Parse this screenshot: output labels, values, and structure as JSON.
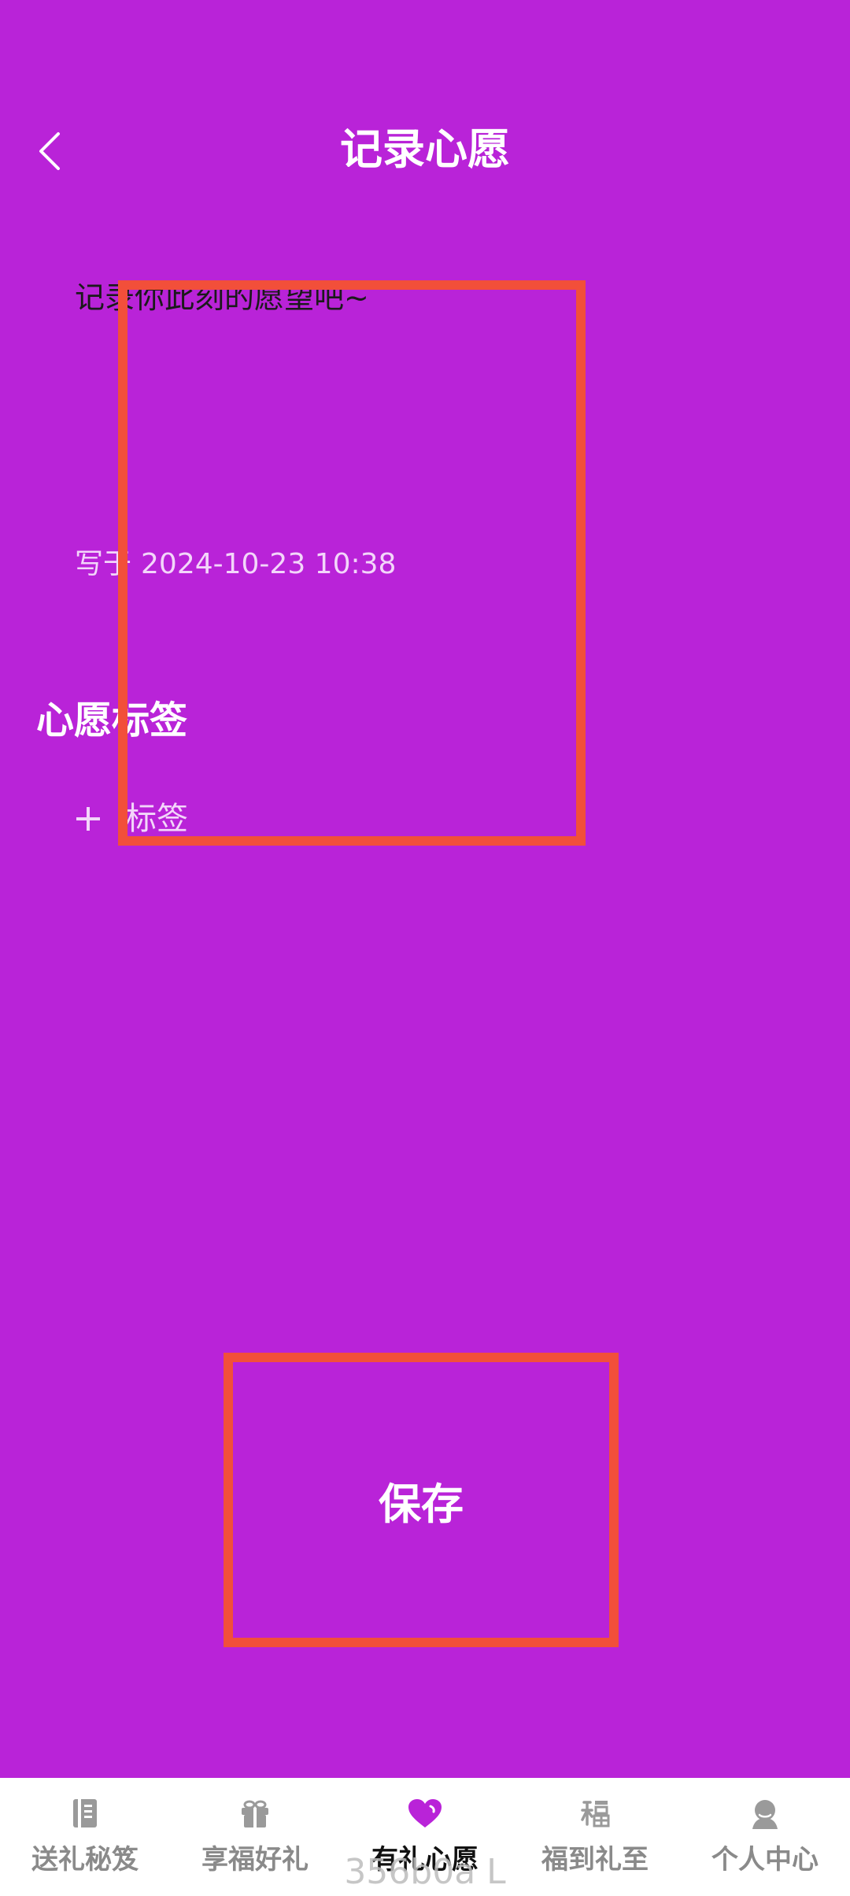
{
  "header": {
    "title": "记录心愿",
    "back_icon": "chevron-left-icon"
  },
  "editor": {
    "placeholder": "记录你此刻的愿望吧~",
    "written_prefix": "写于",
    "written_at": "2024-10-23 10:38"
  },
  "tags": {
    "heading": "心愿标签",
    "add_label": "标签",
    "add_icon": "plus-icon"
  },
  "actions": {
    "save_label": "保存"
  },
  "tabbar": {
    "items": [
      {
        "label": "送礼秘笈",
        "icon": "book-icon",
        "active": false
      },
      {
        "label": "享福好礼",
        "icon": "gift-icon",
        "active": false
      },
      {
        "label": "有礼心愿",
        "icon": "heart-icon",
        "active": true
      },
      {
        "label": "福到礼至",
        "icon": "fu-character-icon",
        "active": false
      },
      {
        "label": "个人中心",
        "icon": "person-icon",
        "active": false
      }
    ]
  },
  "watermark": "356b0a L",
  "colors": {
    "background": "#b923d8",
    "highlight": "#f24f3a",
    "tab_active_icon": "#b923d8",
    "tab_inactive": "#8a8a8a"
  }
}
